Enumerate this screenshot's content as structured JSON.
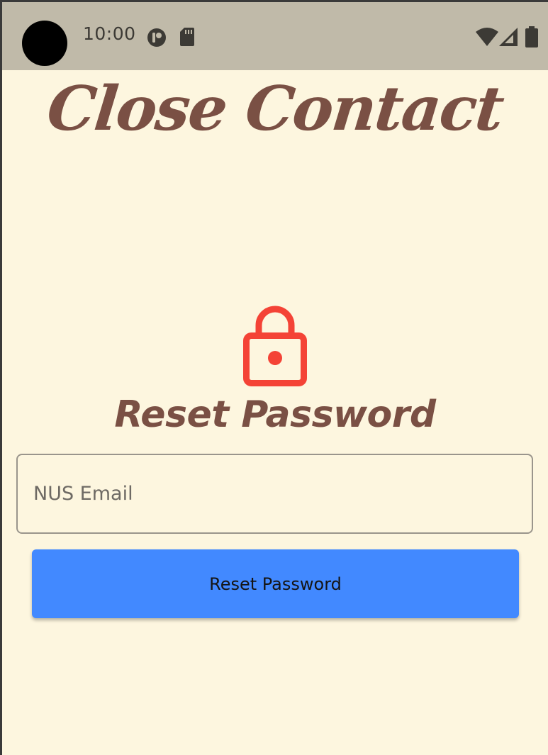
{
  "status_bar": {
    "time": "10:00",
    "left_icons": [
      "accessibility-icon",
      "sd-card-icon"
    ],
    "right_icons": [
      "wifi-icon",
      "cell-signal-icon",
      "battery-icon"
    ]
  },
  "app": {
    "title": "Close Contact",
    "brand_color": "#7a5044",
    "background_color": "#fdf6df"
  },
  "reset": {
    "icon": "lock-icon",
    "icon_color": "#f44336",
    "heading": "Reset Password",
    "email_placeholder": "NUS Email",
    "email_value": "",
    "button_label": "Reset Password",
    "button_color": "#4289ff"
  }
}
